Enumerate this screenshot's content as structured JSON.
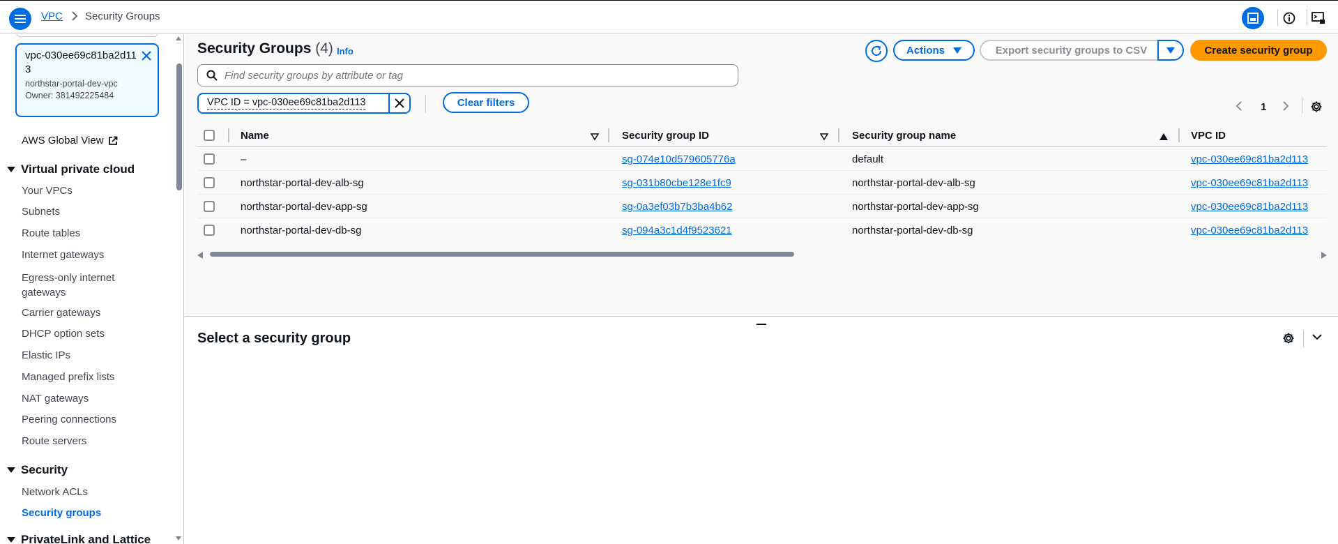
{
  "breadcrumb": {
    "root": "VPC",
    "current": "Security Groups"
  },
  "icons": {
    "menu": "menu-icon",
    "chevron_right": "chevron-right-icon",
    "split_panel": "split-panel-icon",
    "info": "info-icon",
    "cloudshell": "cloudshell-icon",
    "close": "close-icon",
    "external": "external-link-icon",
    "caret_down": "caret-down-icon",
    "refresh": "refresh-icon",
    "search": "search-icon",
    "gear": "gear-icon",
    "sort_desc": "sort-desc-icon",
    "sort_asc": "sort-asc-icon"
  },
  "colors": {
    "accent": "#006ce0",
    "primary_button": "#ff9900",
    "text": "#0f141a",
    "muted": "#424650"
  },
  "sidebar": {
    "vpc_filter": {
      "title": "vpc-030ee69c81ba2d113",
      "subtitle": "northstar-portal-dev-vpc",
      "owner": "Owner: 381492225484"
    },
    "global_view": "AWS Global View",
    "sections": [
      {
        "title": "Virtual private cloud",
        "items": [
          "Your VPCs",
          "Subnets",
          "Route tables",
          "Internet gateways",
          "Egress-only internet gateways",
          "Carrier gateways",
          "DHCP option sets",
          "Elastic IPs",
          "Managed prefix lists",
          "NAT gateways",
          "Peering connections",
          "Route servers"
        ]
      },
      {
        "title": "Security",
        "items": [
          "Network ACLs",
          "Security groups"
        ]
      },
      {
        "title": "PrivateLink and Lattice",
        "items": []
      }
    ],
    "active_item": "Security groups"
  },
  "main": {
    "title": "Security Groups",
    "count": "(4)",
    "info": "Info",
    "actions_label": "Actions",
    "export_label": "Export security groups to CSV",
    "create_label": "Create security group",
    "search_placeholder": "Find security groups by attribute or tag",
    "filter_chip": "VPC ID = vpc-030ee69c81ba2d113",
    "clear_filters": "Clear filters",
    "page": "1"
  },
  "table": {
    "columns": [
      "Name",
      "Security group ID",
      "Security group name",
      "VPC ID"
    ],
    "rows": [
      {
        "name": "–",
        "id": "sg-074e10d579605776a",
        "group_name": "default",
        "vpc": "vpc-030ee69c81ba2d113"
      },
      {
        "name": "northstar-portal-dev-alb-sg",
        "id": "sg-031b80cbe128e1fc9",
        "group_name": "northstar-portal-dev-alb-sg",
        "vpc": "vpc-030ee69c81ba2d113"
      },
      {
        "name": "northstar-portal-dev-app-sg",
        "id": "sg-0a3ef03b7b3ba4b62",
        "group_name": "northstar-portal-dev-app-sg",
        "vpc": "vpc-030ee69c81ba2d113"
      },
      {
        "name": "northstar-portal-dev-db-sg",
        "id": "sg-094a3c1d4f9523621",
        "group_name": "northstar-portal-dev-db-sg",
        "vpc": "vpc-030ee69c81ba2d113"
      }
    ]
  },
  "split_panel": {
    "title": "Select a security group"
  }
}
